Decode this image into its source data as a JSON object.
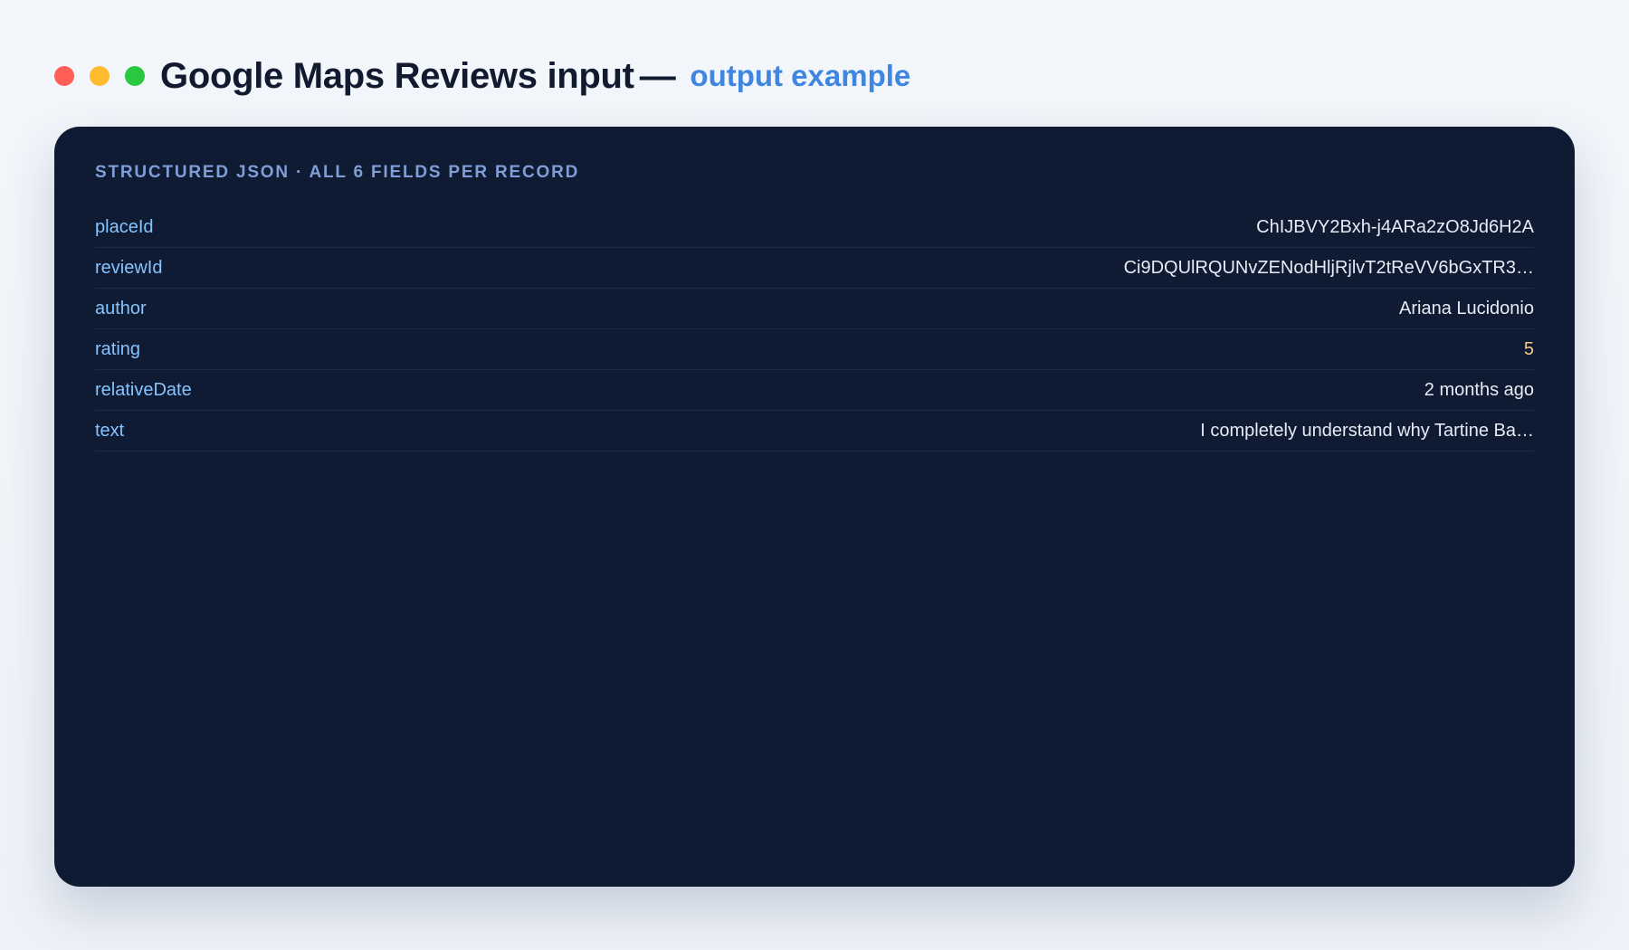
{
  "window_controls": {
    "close_color": "#ff5f57",
    "minimize_color": "#febc2e",
    "zoom_color": "#28c840"
  },
  "header": {
    "title": "Google Maps Reviews input",
    "dash": "—",
    "subtitle": "output example",
    "subtitle_color": "#3f86e0"
  },
  "card": {
    "heading": "STRUCTURED JSON · ALL 6 FIELDS PER RECORD",
    "fields": [
      {
        "key": "placeId",
        "value": "ChIJBVY2Bxh-j4ARa2zO8Jd6H2A"
      },
      {
        "key": "reviewId",
        "value": "Ci9DQUlRQUNvZENodHljRjlvT2tReVV6bGxTR3…"
      },
      {
        "key": "author",
        "value": "Ariana Lucidonio"
      },
      {
        "key": "rating",
        "value": "5"
      },
      {
        "key": "relativeDate",
        "value": "2 months ago"
      },
      {
        "key": "text",
        "value": "I completely understand why Tartine Ba…"
      }
    ]
  },
  "colors": {
    "card_background": "#0f1a33",
    "key_text": "#86c4ff",
    "value_text": "#e6ebf4",
    "number_value": "#f5c98a"
  }
}
